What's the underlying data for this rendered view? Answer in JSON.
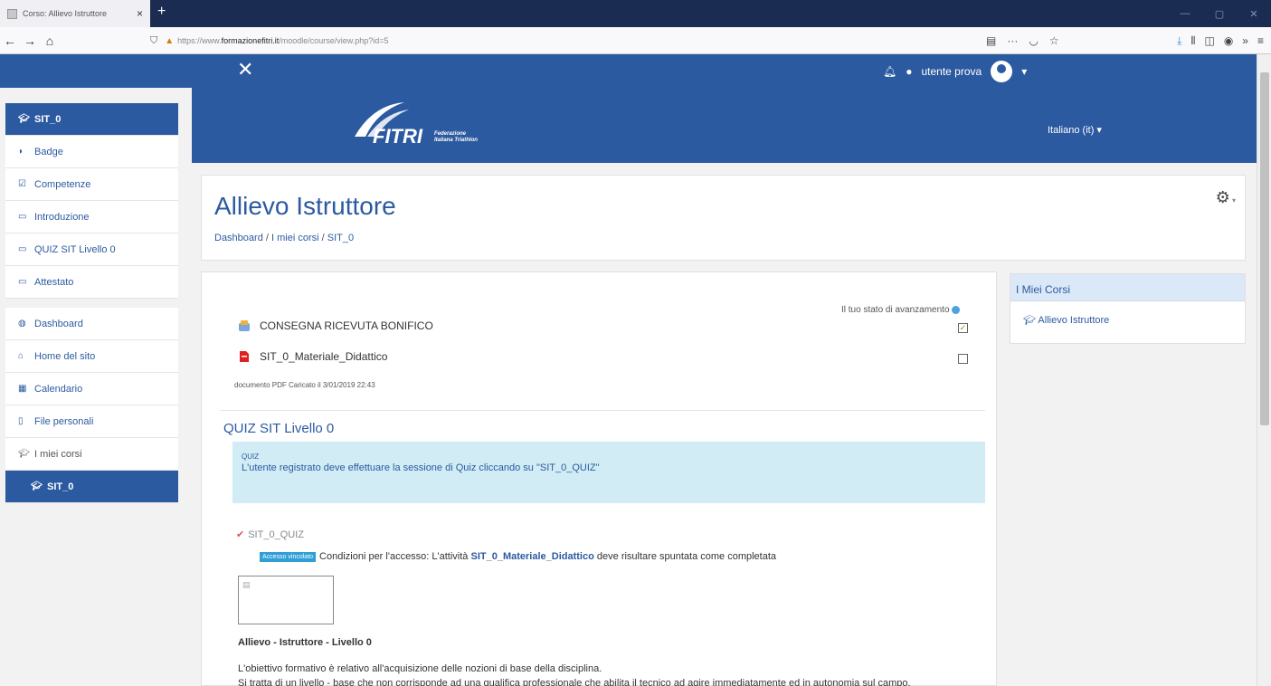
{
  "browser": {
    "tab_title": "Corso: Allievo Istruttore",
    "tab_close": "×",
    "new_tab": "+",
    "url_prefix": "https://www.",
    "url_domain": "formazionefitri.it",
    "url_path": "/moodle/course/view.php?id=5"
  },
  "header": {
    "user_name": "utente prova"
  },
  "drawer": {
    "course": "SIT_0",
    "items": [
      "Badge",
      "Competenze",
      "Introduzione",
      "QUIZ SIT Livello 0",
      "Attestato"
    ],
    "nav": [
      "Dashboard",
      "Home del sito",
      "Calendario",
      "File personali",
      "I miei corsi"
    ],
    "current": "SIT_0"
  },
  "banner": {
    "brand": "FITRI",
    "brand_sub1": "Federazione",
    "brand_sub2": "Italiana Triathlon",
    "language": "Italiano (it) ▾"
  },
  "course_header": {
    "title": "Allievo Istruttore",
    "crumb_1": "Dashboard",
    "crumb_2": "I miei corsi",
    "crumb_3": "SIT_0"
  },
  "main": {
    "progress_label": "Il tuo stato di avanzamento",
    "activity_1": "CONSEGNA RICEVUTA BONIFICO",
    "activity_2": "SIT_0_Materiale_Didattico",
    "activity_2_meta": "documento PDF Caricato il 3/01/2019 22:43",
    "section_title": "QUIZ SIT Livello 0",
    "quiz_label": "QUIZ",
    "quiz_text": "L'utente registrato deve effettuare la sessione di Quiz cliccando su \"SIT_0_QUIZ\"",
    "quiz_item": "SIT_0_QUIZ",
    "restricted_badge": "Accesso vincolato",
    "restriction_pre": "Condizioni per l'accesso: L'attività",
    "restriction_activity": "SIT_0_Materiale_Didattico",
    "restriction_post": "deve risultare spuntata come completata",
    "course_name": "Allievo - Istruttore - Livello 0",
    "description_1": "L'obiettivo formativo è relativo all'acquisizione delle nozioni di base della disciplina.",
    "description_2": "Si tratta di un livello - base che non corrisponde ad una qualifica professionale che abilita il tecnico ad agire immediatamente ed in autonomia sul campo."
  },
  "right_block": {
    "title": "I Miei Corsi",
    "item": "Allievo Istruttore"
  },
  "colors": {
    "primary": "#2c5aa0",
    "info_box": "#d1ecf5",
    "badge": "#2f9fd6"
  }
}
